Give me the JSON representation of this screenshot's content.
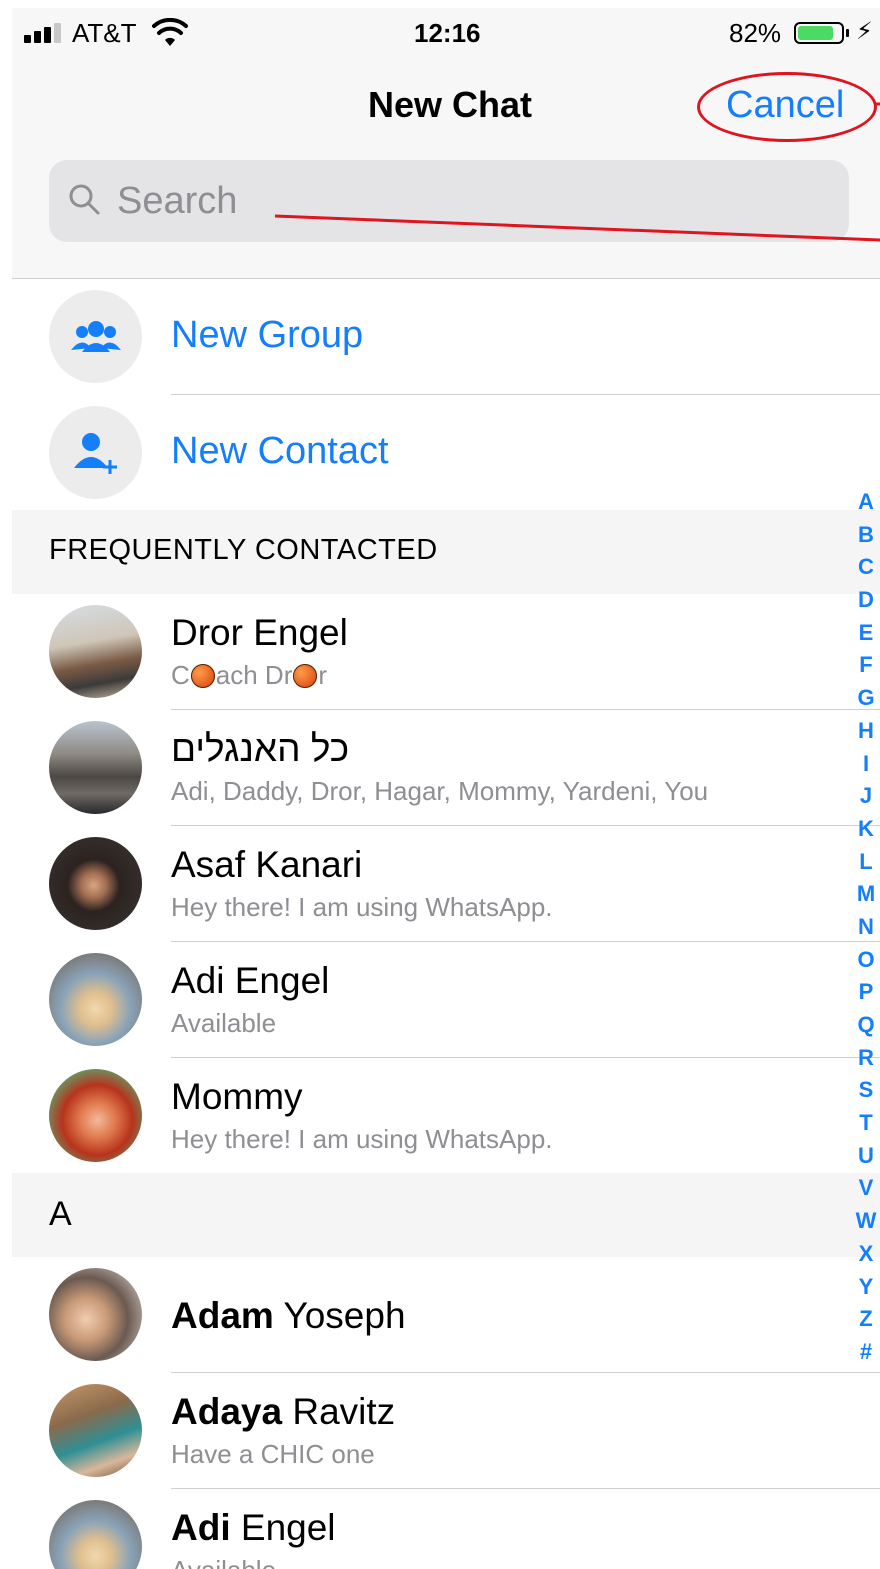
{
  "status_bar": {
    "carrier": "AT&T",
    "time": "12:16",
    "battery": "82%"
  },
  "header": {
    "title": "New Chat",
    "cancel_label": "Cancel"
  },
  "search": {
    "placeholder": "Search"
  },
  "actions": [
    {
      "label": "New Group",
      "icon": "group-icon"
    },
    {
      "label": "New Contact",
      "icon": "add-contact-icon"
    }
  ],
  "sections": {
    "frequent": "FREQUENTLY CONTACTED",
    "a": "A"
  },
  "frequent_contacts": [
    {
      "name": "Dror Engel",
      "status_parts": [
        "C",
        "ach Dr",
        "r"
      ]
    },
    {
      "name": "כל האנגלים",
      "status": "Adi, Daddy, Dror, Hagar, Mommy, Yardeni, You"
    },
    {
      "name": "Asaf Kanari",
      "status": "Hey there! I am using WhatsApp."
    },
    {
      "name": "Adi Engel",
      "status": "Available"
    },
    {
      "name": "Mommy",
      "status": "Hey there! I am using WhatsApp."
    }
  ],
  "a_contacts": [
    {
      "first": "Adam",
      "last": " Yoseph",
      "status": ""
    },
    {
      "first": "Adaya",
      "last": " Ravitz",
      "status": "Have a CHIC one"
    },
    {
      "first": "Adi",
      "last": " Engel",
      "status": "Available"
    }
  ],
  "index_letters": [
    "A",
    "B",
    "C",
    "D",
    "E",
    "F",
    "G",
    "H",
    "I",
    "J",
    "K",
    "L",
    "M",
    "N",
    "O",
    "P",
    "Q",
    "R",
    "S",
    "T",
    "U",
    "V",
    "W",
    "X",
    "Y",
    "Z",
    "#"
  ],
  "colors": {
    "accent": "#147efb",
    "annotation": "#e0141e",
    "battery": "#4cd964"
  }
}
